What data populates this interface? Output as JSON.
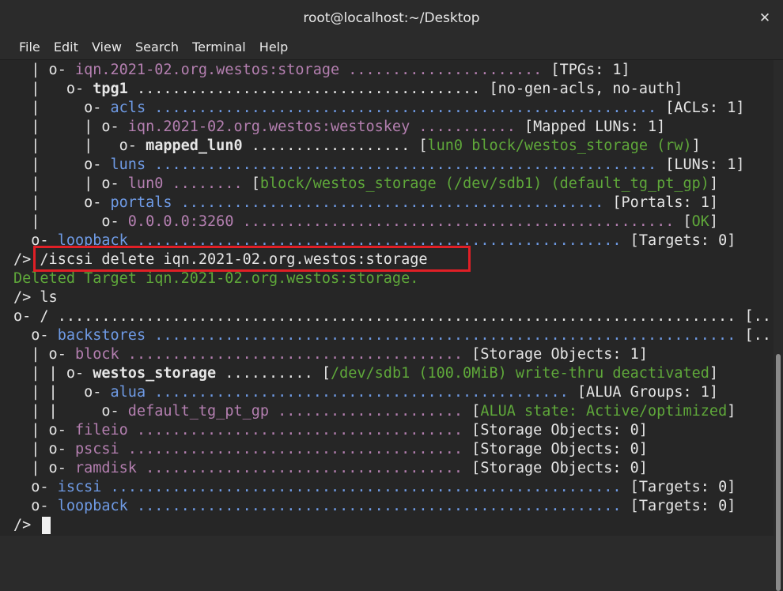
{
  "window": {
    "title": "root@localhost:~/Desktop",
    "close_glyph": "✕"
  },
  "menu": [
    "File",
    "Edit",
    "View",
    "Search",
    "Terminal",
    "Help"
  ],
  "terminal_lines": [
    [
      [
        "w",
        "  | o- "
      ],
      [
        "p",
        "iqn.2021-02.org.westos:storage"
      ],
      [
        "p",
        " ......................"
      ],
      [
        "w",
        " [TPGs: 1]"
      ]
    ],
    [
      [
        "w",
        "  |   o- "
      ],
      [
        "b",
        "tpg1"
      ],
      [
        "w",
        " ....................................... [no-gen-acls, no-auth]"
      ]
    ],
    [
      [
        "w",
        "  |     o- "
      ],
      [
        "bl",
        "acls"
      ],
      [
        "bl",
        " ........................................................."
      ],
      [
        "w",
        " [ACLs: 1]"
      ]
    ],
    [
      [
        "w",
        "  |     | o- "
      ],
      [
        "p",
        "iqn.2021-02.org.westos:westoskey"
      ],
      [
        "p",
        " ..........."
      ],
      [
        "w",
        " [Mapped LUNs: 1]"
      ]
    ],
    [
      [
        "w",
        "  |     |   o- "
      ],
      [
        "b",
        "mapped_lun0"
      ],
      [
        "w",
        " .................. ["
      ],
      [
        "g",
        "lun0 block/westos_storage (rw)"
      ],
      [
        "w",
        "]"
      ]
    ],
    [
      [
        "w",
        "  |     o- "
      ],
      [
        "bl",
        "luns"
      ],
      [
        "bl",
        " ........................................................."
      ],
      [
        "w",
        " [LUNs: 1]"
      ]
    ],
    [
      [
        "w",
        "  |     | o- "
      ],
      [
        "p",
        "lun0"
      ],
      [
        "p",
        " ........"
      ],
      [
        "w",
        " ["
      ],
      [
        "g",
        "block/westos_storage (/dev/sdb1) (default_tg_pt_gp)"
      ],
      [
        "w",
        "]"
      ]
    ],
    [
      [
        "w",
        "  |     o- "
      ],
      [
        "bl",
        "portals"
      ],
      [
        "bl",
        " ................................................"
      ],
      [
        "w",
        " [Portals: 1]"
      ]
    ],
    [
      [
        "w",
        "  |       o- "
      ],
      [
        "p",
        "0.0.0.0:3260"
      ],
      [
        "p",
        " ................................................."
      ],
      [
        "w",
        " ["
      ],
      [
        "g",
        "OK"
      ],
      [
        "w",
        "]"
      ]
    ],
    [
      [
        "w",
        "  o- "
      ],
      [
        "bl",
        "loopback"
      ],
      [
        "bl",
        " ......................................................."
      ],
      [
        "w",
        " [Targets: 0]"
      ]
    ],
    [
      [
        "w",
        "/> /iscsi delete iqn.2021-02.org.westos:storage"
      ]
    ],
    [
      [
        "g",
        "Deleted Target iqn.2021-02.org.westos:storage."
      ]
    ],
    [
      [
        "w",
        "/> ls"
      ]
    ],
    [
      [
        "w",
        "o- / ............................................................................. [...]"
      ]
    ],
    [
      [
        "w",
        "  o- "
      ],
      [
        "bl",
        "backstores"
      ],
      [
        "bl",
        " .................................................................."
      ],
      [
        "w",
        " [...]"
      ]
    ],
    [
      [
        "w",
        "  | o- "
      ],
      [
        "p",
        "block"
      ],
      [
        "p",
        " ......................................"
      ],
      [
        "w",
        " [Storage Objects: 1]"
      ]
    ],
    [
      [
        "w",
        "  | | o- "
      ],
      [
        "b",
        "westos_storage"
      ],
      [
        "w",
        " .......... ["
      ],
      [
        "g",
        "/dev/sdb1 (100.0MiB) write-thru deactivated"
      ],
      [
        "w",
        "]"
      ]
    ],
    [
      [
        "w",
        "  | |   o- "
      ],
      [
        "bl",
        "alua"
      ],
      [
        "bl",
        " ..............................................."
      ],
      [
        "w",
        " [ALUA Groups: 1]"
      ]
    ],
    [
      [
        "w",
        "  | |     o- "
      ],
      [
        "p",
        "default_tg_pt_gp"
      ],
      [
        "p",
        " ....................."
      ],
      [
        "w",
        " ["
      ],
      [
        "g",
        "ALUA state: Active/optimized"
      ],
      [
        "w",
        "]"
      ]
    ],
    [
      [
        "w",
        "  | o- "
      ],
      [
        "p",
        "fileio"
      ],
      [
        "p",
        " ....................................."
      ],
      [
        "w",
        " [Storage Objects: 0]"
      ]
    ],
    [
      [
        "w",
        "  | o- "
      ],
      [
        "p",
        "pscsi"
      ],
      [
        "p",
        " ......................................"
      ],
      [
        "w",
        " [Storage Objects: 0]"
      ]
    ],
    [
      [
        "w",
        "  | o- "
      ],
      [
        "p",
        "ramdisk"
      ],
      [
        "p",
        " ...................................."
      ],
      [
        "w",
        " [Storage Objects: 0]"
      ]
    ],
    [
      [
        "w",
        "  o- "
      ],
      [
        "bl",
        "iscsi"
      ],
      [
        "bl",
        " .........................................................."
      ],
      [
        "w",
        " [Targets: 0]"
      ]
    ],
    [
      [
        "w",
        "  o- "
      ],
      [
        "bl",
        "loopback"
      ],
      [
        "bl",
        " ......................................................."
      ],
      [
        "w",
        " [Targets: 0]"
      ]
    ],
    [
      [
        "w",
        "/> "
      ]
    ]
  ]
}
